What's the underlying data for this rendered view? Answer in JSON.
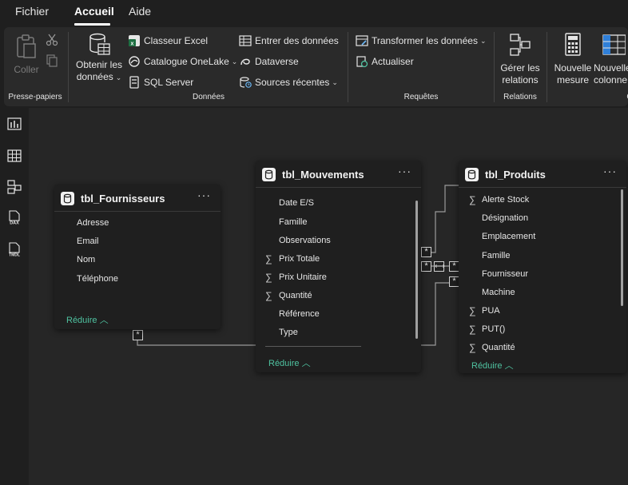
{
  "menu": {
    "tabs": [
      "Fichier",
      "Accueil",
      "Aide"
    ],
    "active": "Accueil"
  },
  "ribbon": {
    "clipboard": {
      "paste": "Coller",
      "group": "Presse-papiers"
    },
    "data": {
      "get_data_line1": "Obtenir les",
      "get_data_line2": "données",
      "excel": "Classeur Excel",
      "onelake": "Catalogue OneLake",
      "sql": "SQL Server",
      "enter_data": "Entrer des données",
      "dataverse": "Dataverse",
      "recent": "Sources récentes",
      "group": "Données"
    },
    "queries": {
      "transform": "Transformer les données",
      "refresh": "Actualiser",
      "group": "Requêtes"
    },
    "relations": {
      "manage_line1": "Gérer les",
      "manage_line2": "relations",
      "group": "Relations"
    },
    "calc": {
      "new_measure_line1": "Nouvelle",
      "new_measure_line2": "mesure",
      "new_column_line1": "Nouvelle",
      "new_column_line2": "colonne",
      "group": "C"
    }
  },
  "rail": {
    "items": [
      "report-view",
      "table-view",
      "model-view",
      "dax-view",
      "tmdl-view"
    ],
    "dax_label": "DAX",
    "tmdl_label": "TMDL"
  },
  "tables": {
    "fournisseurs": {
      "title": "tbl_Fournisseurs",
      "more": "···",
      "fields": [
        {
          "name": "Adresse",
          "sigma": false
        },
        {
          "name": "Email",
          "sigma": false
        },
        {
          "name": "Nom",
          "sigma": false
        },
        {
          "name": "Téléphone",
          "sigma": false
        }
      ],
      "reduce": "Réduire"
    },
    "mouvements": {
      "title": "tbl_Mouvements",
      "more": "···",
      "fields": [
        {
          "name": "Date E/S",
          "sigma": false
        },
        {
          "name": "Famille",
          "sigma": false
        },
        {
          "name": "Observations",
          "sigma": false
        },
        {
          "name": "Prix Totale",
          "sigma": true
        },
        {
          "name": "Prix Unitaire",
          "sigma": true
        },
        {
          "name": "Quantité",
          "sigma": true
        },
        {
          "name": "Référence",
          "sigma": false
        },
        {
          "name": "Type",
          "sigma": false
        }
      ],
      "reduce": "Réduire"
    },
    "produits": {
      "title": "tbl_Produits",
      "more": "···",
      "fields": [
        {
          "name": "Alerte Stock",
          "sigma": true
        },
        {
          "name": "Désignation",
          "sigma": false
        },
        {
          "name": "Emplacement",
          "sigma": false
        },
        {
          "name": "Famille",
          "sigma": false
        },
        {
          "name": "Fournisseur",
          "sigma": false
        },
        {
          "name": "Machine",
          "sigma": false
        },
        {
          "name": "PUA",
          "sigma": true
        },
        {
          "name": "PUT()",
          "sigma": true
        },
        {
          "name": "Quantité",
          "sigma": true
        }
      ],
      "reduce": "Réduire"
    }
  },
  "relationship_markers": {
    "many": "*",
    "both": "⟷"
  },
  "colors": {
    "accent_green": "#4fc3a1",
    "excel_green": "#1d6f42",
    "canvas": "#262626",
    "card": "#1f1f1f"
  }
}
